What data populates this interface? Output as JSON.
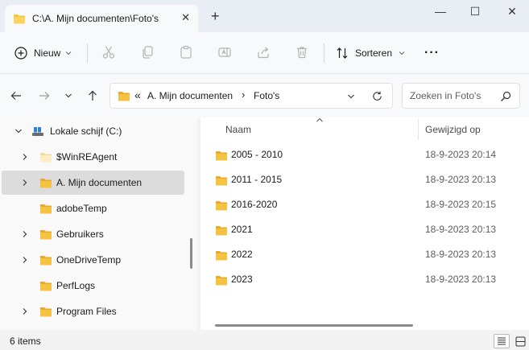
{
  "window": {
    "tab_title": "C:\\A. Mijn documenten\\Foto's",
    "close_tab_glyph": "✕",
    "new_tab_glyph": "+",
    "minimize_glyph": "—",
    "maximize_glyph": "☐",
    "close_glyph": "✕"
  },
  "toolbar": {
    "new_label": "Nieuw",
    "sort_label": "Sorteren",
    "more_glyph": "···"
  },
  "address": {
    "overflow_glyph": "«",
    "crumbs": [
      "A. Mijn documenten",
      "Foto's"
    ],
    "crumb_separator": "›"
  },
  "search": {
    "placeholder": "Zoeken in Foto's"
  },
  "sidebar": {
    "items": [
      {
        "label": "Lokale schijf (C:)",
        "expanded": true,
        "icon": "drive-icon"
      },
      {
        "label": "$WinREAgent",
        "has_children": true
      },
      {
        "label": "A. Mijn documenten",
        "has_children": true,
        "selected": true
      },
      {
        "label": "adobeTemp",
        "has_children": false
      },
      {
        "label": "Gebruikers",
        "has_children": true
      },
      {
        "label": "OneDriveTemp",
        "has_children": true
      },
      {
        "label": "PerfLogs",
        "has_children": false
      },
      {
        "label": "Program Files",
        "has_children": true
      }
    ]
  },
  "table": {
    "columns": [
      "Naam",
      "Gewijzigd op"
    ],
    "rows": [
      {
        "name": "2005 - 2010",
        "modified": "18-9-2023 20:14"
      },
      {
        "name": "2011 - 2015",
        "modified": "18-9-2023 20:13"
      },
      {
        "name": "2016-2020",
        "modified": "18-9-2023 20:15"
      },
      {
        "name": "2021",
        "modified": "18-9-2023 20:13"
      },
      {
        "name": "2022",
        "modified": "18-9-2023 20:13"
      },
      {
        "name": "2023",
        "modified": "18-9-2023 20:13"
      }
    ]
  },
  "status": {
    "item_count": "6 items"
  },
  "colors": {
    "folder": "#f5c342",
    "folder_dark": "#e8a92c",
    "accent": "#0067c0",
    "selected_row": "#dcdcdc"
  }
}
